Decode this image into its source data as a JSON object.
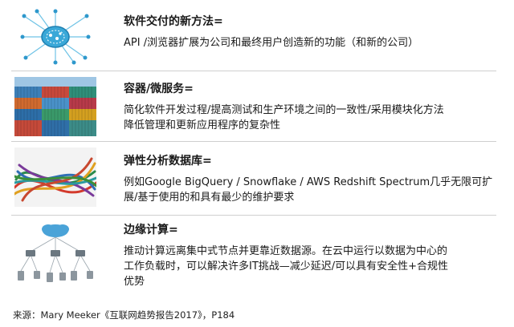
{
  "items": [
    {
      "title": "软件交付的新方法=",
      "desc_lines": [
        "API /浏览器扩展为公司和最终用户创造新的功能（和新的公司）"
      ],
      "image": "api-network-icon"
    },
    {
      "title": "容器/微服务=",
      "desc_lines": [
        "简化软件开发过程/提高测试和生产环境之间的一致性/采用模块化方法",
        "降低管理和更新应用程序的复杂性"
      ],
      "image": "shipping-containers-photo"
    },
    {
      "title": "弹性分析数据库=",
      "desc_lines": [
        "例如Google BigQuery / Snowflake / AWS Redshift Spectrum几乎无限可扩",
        "展/基于使用的和具有最少的维护要求"
      ],
      "image": "rubber-bands-photo"
    },
    {
      "title": "边缘计算=",
      "desc_lines": [
        "推动计算远离集中式节点并更靠近数据源。在云中运行以数据为中心的",
        "工作负载时，可以解决许多IT挑战—减少延迟/可以具有安全性+合规性",
        "优势"
      ],
      "image": "edge-computing-diagram"
    }
  ],
  "source": "来源：Mary Meeker《互联网趋势报告2017》，P184",
  "colors": {
    "accent_blue": "#3aa8d8",
    "divider": "#cfcfcf"
  }
}
